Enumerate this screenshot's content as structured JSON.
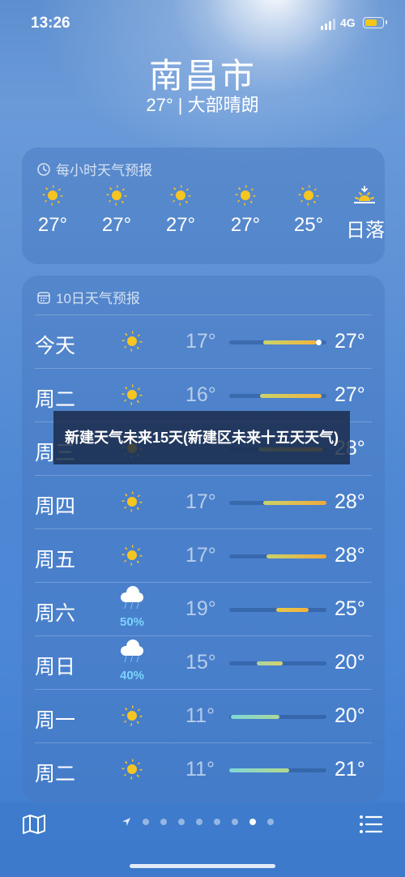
{
  "status_bar": {
    "time": "13:26",
    "network": "4G"
  },
  "header": {
    "city": "南昌市",
    "summary": "27° | 大部晴朗"
  },
  "hourly": {
    "title": "每小时天气预报",
    "items": [
      {
        "temp": "27°",
        "icon": "sun-icon"
      },
      {
        "temp": "27°",
        "icon": "sun-icon"
      },
      {
        "temp": "27°",
        "icon": "sun-icon"
      },
      {
        "temp": "27°",
        "icon": "sun-icon"
      },
      {
        "temp": "25°",
        "icon": "sun-icon"
      },
      {
        "temp": "日落",
        "icon": "sunset-icon"
      }
    ]
  },
  "daily": {
    "title": "10日天气预报",
    "rows": [
      {
        "day": "今天",
        "icon": "sun-icon",
        "pop": "",
        "low": "17°",
        "high": "27°",
        "range": [
          0.35,
          0.9
        ],
        "current": 0.92,
        "color": "linear-gradient(90deg,#c9d46a,#f2b33d)"
      },
      {
        "day": "周二",
        "icon": "sun-icon",
        "pop": "",
        "low": "16°",
        "high": "27°",
        "range": [
          0.32,
          0.95
        ],
        "color": "linear-gradient(90deg,#c9d46a,#f2b33d)"
      },
      {
        "day": "周三",
        "icon": "sun-icon",
        "pop": "",
        "low": "",
        "high": "28°",
        "range": [
          0.3,
          0.97
        ],
        "color": "linear-gradient(90deg,#b9cf6d,#f2a83a)"
      },
      {
        "day": "周四",
        "icon": "sun-icon",
        "pop": "",
        "low": "17°",
        "high": "28°",
        "range": [
          0.35,
          1.0
        ],
        "color": "linear-gradient(90deg,#c9d46a,#f2a83a)"
      },
      {
        "day": "周五",
        "icon": "sun-icon",
        "pop": "",
        "low": "17°",
        "high": "28°",
        "range": [
          0.38,
          1.0
        ],
        "color": "linear-gradient(90deg,#c9d46a,#f2a83a)"
      },
      {
        "day": "周六",
        "icon": "rain-cloud-icon",
        "pop": "50%",
        "low": "19°",
        "high": "25°",
        "range": [
          0.48,
          0.82
        ],
        "color": "linear-gradient(90deg,#e6c94a,#f2b33d)"
      },
      {
        "day": "周日",
        "icon": "rain-cloud-icon",
        "pop": "40%",
        "low": "15°",
        "high": "20°",
        "range": [
          0.28,
          0.55
        ],
        "color": "linear-gradient(90deg,#a9d3a0,#d9d26a)"
      },
      {
        "day": "周一",
        "icon": "sun-icon",
        "pop": "",
        "low": "11°",
        "high": "20°",
        "range": [
          0.02,
          0.52
        ],
        "color": "linear-gradient(90deg,#7fd8d6,#a9d89a)"
      },
      {
        "day": "周二",
        "icon": "sun-icon",
        "pop": "",
        "low": "11°",
        "high": "21°",
        "range": [
          0.0,
          0.62
        ],
        "color": "linear-gradient(90deg,#7fd8d6,#b3d98d)"
      }
    ]
  },
  "overlay": {
    "title": "新建天气未来15天(新建区未来十五天天气)"
  },
  "pager": {
    "total": 8,
    "active": 7
  },
  "colors": {
    "sun": "#f5c521",
    "precip": "#7cd3ff",
    "overlay": "#19284688"
  }
}
